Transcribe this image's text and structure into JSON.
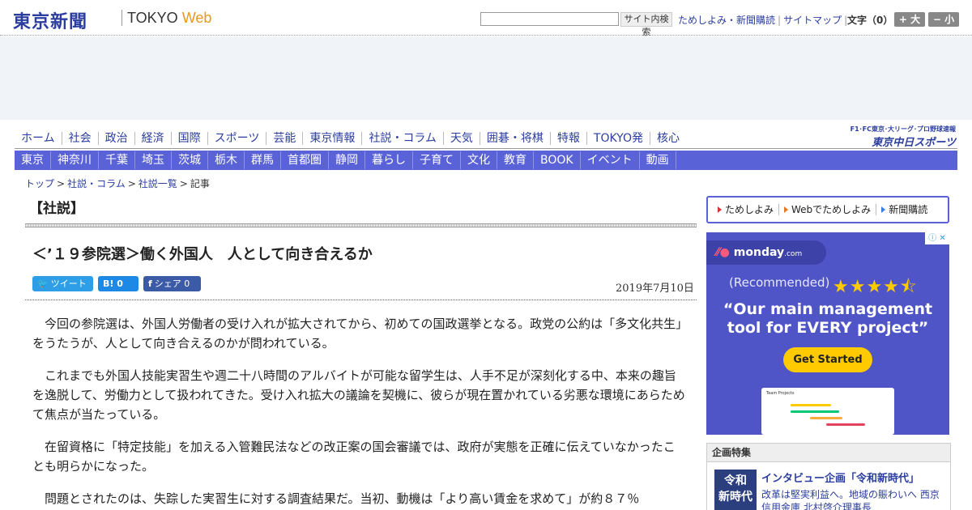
{
  "header": {
    "logo_ja": "東京新聞",
    "logo_en": "TOKYO ",
    "logo_web": "Web",
    "search_placeholder": "",
    "search_button": "サイト内検索",
    "links": [
      "ためしよみ・新聞購読",
      "サイトマップ"
    ],
    "font_size_label": "文字（0）",
    "font_bigger": "+ 大",
    "font_smaller": "− 小"
  },
  "main_nav": [
    "ホーム",
    "社会",
    "政治",
    "経済",
    "国際",
    "スポーツ",
    "芸能",
    "東京情報",
    "社説・コラム",
    "天気",
    "囲碁・将棋",
    "特報",
    "TOKYO発",
    "核心"
  ],
  "chunichi": {
    "tagline": "F1･FC東京･大リーグ･プロ野球速報",
    "name": "東京中日スポーツ"
  },
  "sub_nav": [
    "東京",
    "神奈川",
    "千葉",
    "埼玉",
    "茨城",
    "栃木",
    "群馬",
    "首都圏",
    "静岡",
    "暮らし",
    "子育て",
    "文化",
    "教育",
    "BOOK",
    "イベント",
    "動画"
  ],
  "breadcrumb": [
    "トップ",
    "社説・コラム",
    "社説一覧",
    "記事"
  ],
  "section_title": "【社説】",
  "article": {
    "headline": "＜’１９参院選＞働く外国人　人として向き合えるか",
    "share": {
      "tweet": "ツイート",
      "hatena": "B!",
      "hatena_count": "0",
      "facebook": "シェア",
      "facebook_count": "0"
    },
    "date": "2019年7月10日",
    "paragraphs": [
      "今回の参院選は、外国人労働者の受け入れが拡大されてから、初めての国政選挙となる。政党の公約は「多文化共生」をうたうが、人として向き合えるのかが問われている。",
      "これまでも外国人技能実習生や週二十八時間のアルバイトが可能な留学生は、人手不足が深刻化する中、本来の趣旨を逸脱して、労働力として扱われてきた。受け入れ拡大の議論を契機に、彼らが現在置かれている劣悪な環境にあらためて焦点が当たっている。",
      "在留資格に「特定技能」を加える入管難民法などの改正案の国会審議では、政府が実態を正確に伝えていなかったことも明らかになった。",
      "問題とされたのは、失踪した実習生に対する調査結果だ。当初、動機は「より高い賃金を求めて」が約８７％"
    ]
  },
  "subscribe": [
    "ためしよみ",
    "Webでためしよみ",
    "新聞購読"
  ],
  "ad": {
    "brand": "monday",
    "brand_suffix": ".com",
    "recommended": "(Recommended)",
    "stars": "★★★★⯪",
    "headline": "“Our main management tool for EVERY project”",
    "cta": "Get Started",
    "screenshot_title": "Team Projects"
  },
  "feature": {
    "header": "企画特集",
    "thumb_line1": "令和",
    "thumb_line2": "新時代",
    "title": "インタビュー企画「令和新時代」",
    "text": "改革は堅実利益へ。地域の賑わいへ 西京信用金庫 北村啓介理事長"
  },
  "colors": {
    "brand_blue": "#2b3e9e",
    "nav_blue": "#5a62d8",
    "ad_purple": "#4f55c7",
    "cta_yellow": "#ffcb00"
  }
}
